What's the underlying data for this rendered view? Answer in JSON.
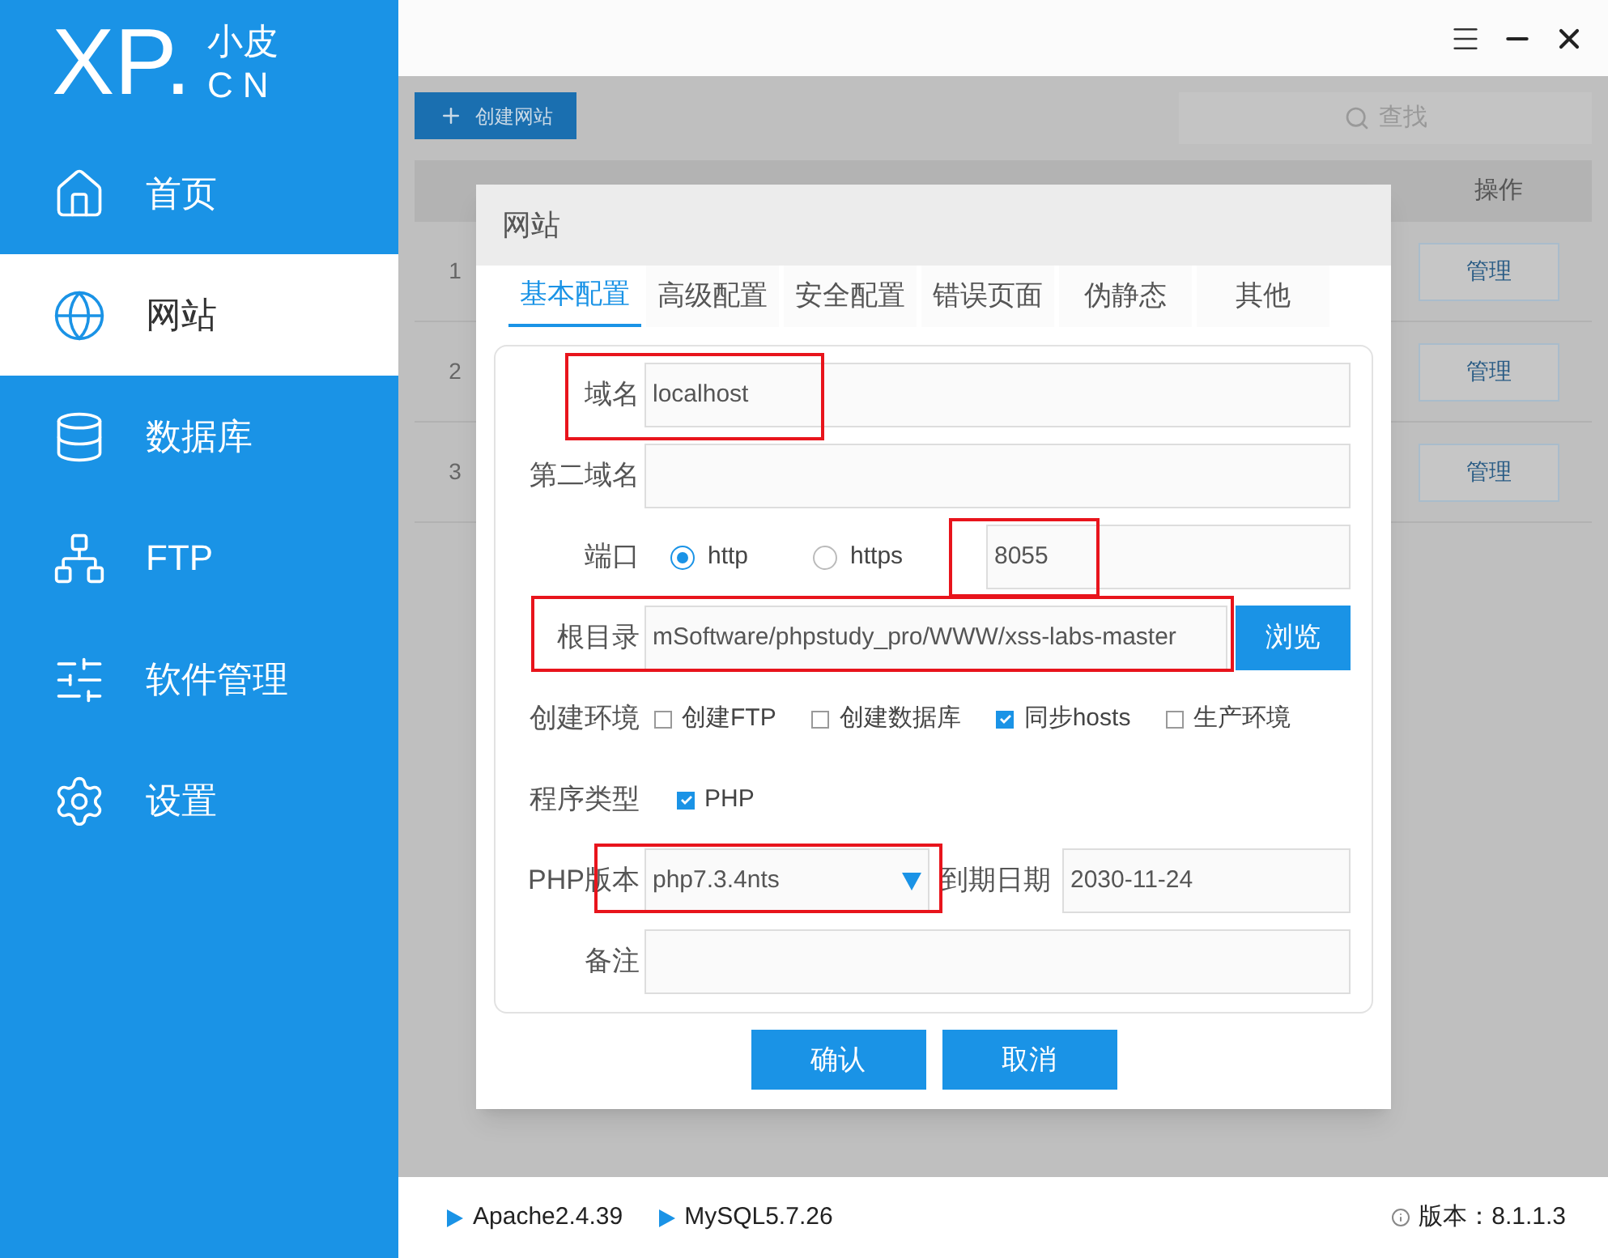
{
  "logo": {
    "main": "XP.",
    "sub_top": "小皮",
    "sub_bottom": "CN"
  },
  "sidebar": {
    "items": [
      {
        "label": "首页",
        "selected": false
      },
      {
        "label": "网站",
        "selected": true
      },
      {
        "label": "数据库",
        "selected": false
      },
      {
        "label": "FTP",
        "selected": false
      },
      {
        "label": "软件管理",
        "selected": false
      },
      {
        "label": "设置",
        "selected": false
      }
    ]
  },
  "toolbar": {
    "create_button": "创建网站",
    "search_placeholder": "查找"
  },
  "table": {
    "columns": [
      {
        "label": "操作"
      }
    ],
    "rows": [
      {
        "index": "1",
        "action": "管理"
      },
      {
        "index": "2",
        "action": "管理"
      },
      {
        "index": "3",
        "action": "管理"
      }
    ]
  },
  "dialog": {
    "title": "网站",
    "tabs": [
      {
        "label": "基本配置",
        "selected": true
      },
      {
        "label": "高级配置",
        "selected": false
      },
      {
        "label": "安全配置",
        "selected": false
      },
      {
        "label": "错误页面",
        "selected": false
      },
      {
        "label": "伪静态",
        "selected": false
      },
      {
        "label": "其他",
        "selected": false
      }
    ],
    "domain": {
      "label": "域名",
      "value": "localhost"
    },
    "second_domain": {
      "label": "第二域名"
    },
    "port": {
      "label": "端口",
      "options": [
        {
          "label": "http",
          "selected": true
        },
        {
          "label": "https",
          "selected": false
        }
      ],
      "value": "8055"
    },
    "root": {
      "label": "根目录",
      "value": "mSoftware/phpstudy_pro/WWW/xss-labs-master",
      "button": "浏览"
    },
    "environment": {
      "label": "创建环境",
      "options": [
        {
          "label": "创建FTP",
          "checked": false
        },
        {
          "label": "创建数据库",
          "checked": false
        },
        {
          "label": "同步hosts",
          "checked": true
        },
        {
          "label": "生产环境",
          "checked": false
        }
      ]
    },
    "program_type": {
      "label": "程序类型",
      "options": [
        {
          "label": "PHP",
          "checked": true
        }
      ]
    },
    "php_version": {
      "label": "PHP版本",
      "value": "php7.3.4nts"
    },
    "expiry": {
      "label": "到期日期",
      "value": "2030-11-24"
    },
    "note": {
      "label": "备注"
    },
    "buttons": [
      "确认",
      "取消"
    ]
  },
  "status_bar": {
    "services": [
      "Apache2.4.39",
      "MySQL5.7.26"
    ],
    "version": "版本：8.1.1.3"
  }
}
